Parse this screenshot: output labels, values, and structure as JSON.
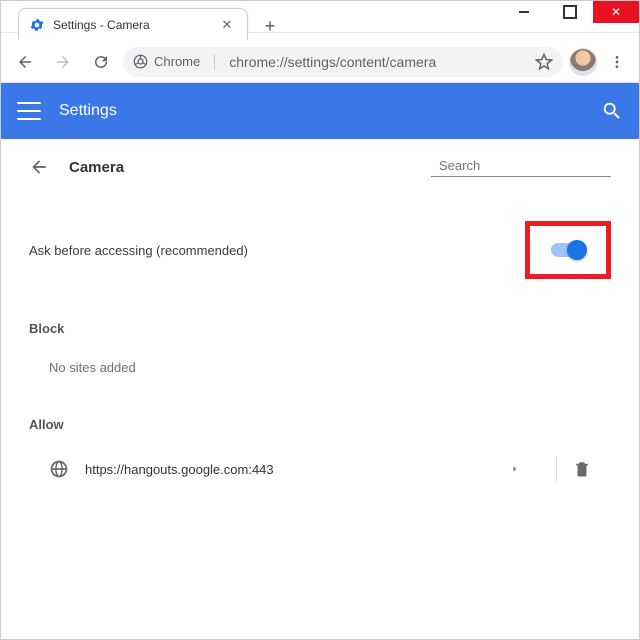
{
  "window": {
    "tab_title": "Settings - Camera",
    "omnibox_label": "Chrome",
    "url": "chrome://settings/content/camera"
  },
  "header": {
    "title": "Settings"
  },
  "page": {
    "title": "Camera",
    "search_placeholder": "Search",
    "ask_label": "Ask before accessing (recommended)",
    "block_heading": "Block",
    "block_empty": "No sites added",
    "allow_heading": "Allow",
    "allow_sites": [
      {
        "url": "https://hangouts.google.com:443"
      }
    ]
  }
}
